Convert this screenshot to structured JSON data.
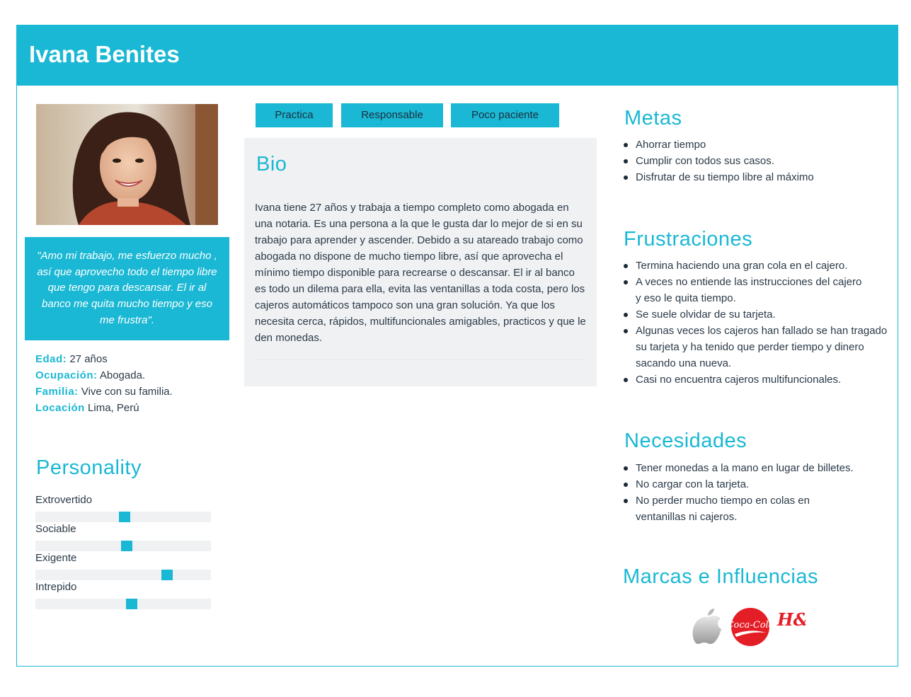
{
  "persona": {
    "name": "Ivana Benites",
    "quote": "\"Amo mi trabajo, me esfuerzo mucho , así que aprovecho todo el tiempo libre que tengo para descansar. El ir al banco me quita mucho tiempo y eso me frustra\".",
    "facts": [
      {
        "key": "Edad:",
        "value": "27 años"
      },
      {
        "key": "Ocupación:",
        "value": "Abogada."
      },
      {
        "key": "Familia:",
        "value": "Vive con su familia."
      },
      {
        "key": "Locación",
        "value": "Lima, Perú"
      }
    ]
  },
  "personality": {
    "title": "Personality",
    "traits": [
      {
        "label": "Extrovertido",
        "level": 0.51
      },
      {
        "label": "Sociable",
        "level": 0.52
      },
      {
        "label": "Exigente",
        "level": 0.75
      },
      {
        "label": "Intrepido",
        "level": 0.55
      }
    ]
  },
  "tags": [
    "Practica",
    "Responsable",
    "Poco paciente"
  ],
  "bio": {
    "title": "Bio",
    "text": "Ivana tiene 27 años y trabaja a tiempo completo como abogada en una notaria. Es una persona a la que le gusta dar lo mejor de si en su trabajo para aprender y ascender. Debido a su atareado trabajo como abogada no dispone de mucho tiempo libre, así que aprovecha el mínimo tiempo disponible para recrearse o descansar. El ir al banco es todo un dilema para ella, evita las ventanillas a toda costa, pero los cajeros automáticos tampoco son una gran solución. Ya que los necesita cerca, rápidos, multifuncionales  amigables, practicos y que le den monedas."
  },
  "metas": {
    "title": "Metas",
    "items": [
      "Ahorrar tiempo",
      "Cumplir con todos sus casos.",
      "Disfrutar de su tiempo libre al máximo"
    ]
  },
  "frustraciones": {
    "title": "Frustraciones",
    "items": [
      "Termina haciendo una gran cola en el cajero.",
      "A veces no entiende las instrucciones del cajero y eso le quita tiempo.",
      "Se suele olvidar de su tarjeta.",
      "Algunas veces los cajeros han fallado se han tragado su tarjeta y ha tenido que perder tiempo y dinero sacando una nueva.",
      "Casi no encuentra cajeros multifuncionales."
    ]
  },
  "necesidades": {
    "title": "Necesidades",
    "items": [
      "Tener monedas a la mano en lugar de billetes.",
      "No cargar con la tarjeta.",
      "No perder mucho tiempo en colas en ventanillas ni cajeros."
    ]
  },
  "marcas": {
    "title": "Marcas e Influencias",
    "logos": [
      "Coca-Cola",
      "H&M"
    ],
    "icons": [
      "apple-logo-icon",
      "coca-cola-logo",
      "hm-logo"
    ]
  },
  "colors": {
    "accent": "#1ab8d4",
    "panel": "#f0f1f3",
    "text": "#2b3a48"
  }
}
